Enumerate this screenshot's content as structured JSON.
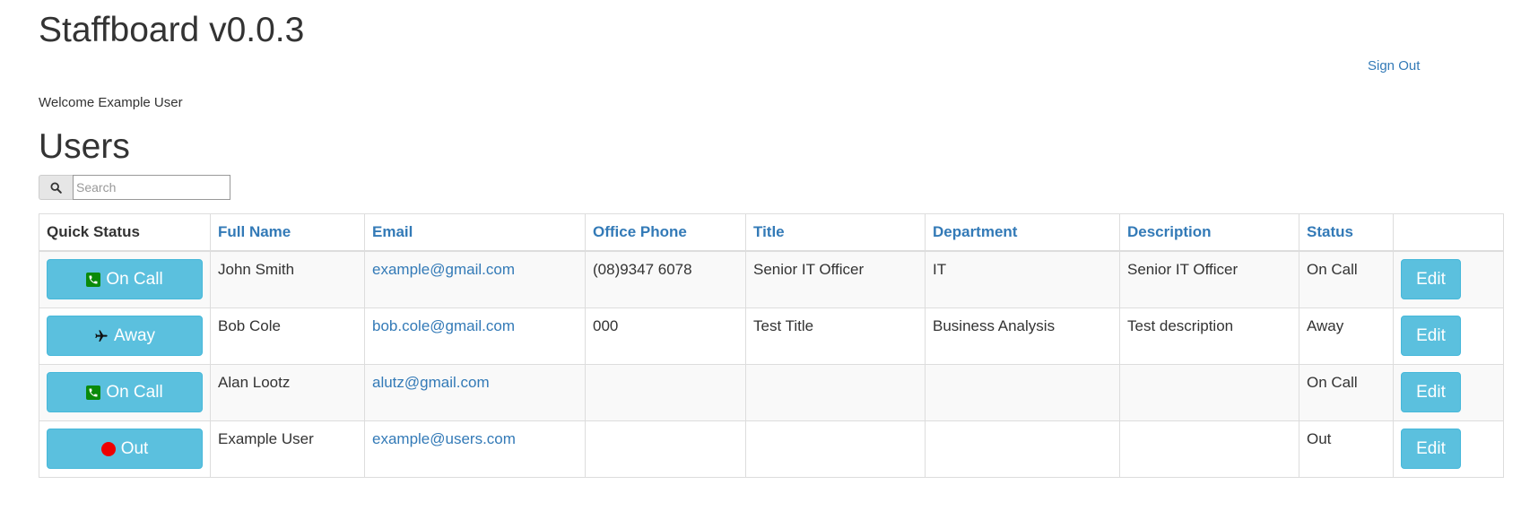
{
  "header": {
    "app_title": "Staffboard v0.0.3",
    "sign_out": "Sign Out",
    "welcome": "Welcome Example User"
  },
  "section_title": "Users",
  "search": {
    "placeholder": "Search",
    "value": ""
  },
  "table": {
    "columns": [
      "Quick Status",
      "Full Name",
      "Email",
      "Office Phone",
      "Title",
      "Department",
      "Description",
      "Status",
      ""
    ],
    "rows": [
      {
        "quick_status": "On Call",
        "quick_icon": "phone-icon",
        "name": "John Smith",
        "email": "example@gmail.com",
        "phone": "(08)9347 6078",
        "title": "Senior IT Officer",
        "department": "IT",
        "description": "Senior IT Officer",
        "status": "On Call",
        "edit": "Edit"
      },
      {
        "quick_status": "Away",
        "quick_icon": "airplane-icon",
        "name": "Bob Cole",
        "email": "bob.cole@gmail.com",
        "phone": "000",
        "title": "Test Title",
        "department": "Business Analysis",
        "description": "Test description",
        "status": "Away",
        "edit": "Edit"
      },
      {
        "quick_status": "On Call",
        "quick_icon": "phone-icon",
        "name": "Alan Lootz",
        "email": "alutz@gmail.com",
        "phone": "",
        "title": "",
        "department": "",
        "description": "",
        "status": "On Call",
        "edit": "Edit"
      },
      {
        "quick_status": "Out",
        "quick_icon": "red-dot-icon",
        "name": "Example User",
        "email": "example@users.com",
        "phone": "",
        "title": "",
        "department": "",
        "description": "",
        "status": "Out",
        "edit": "Edit"
      }
    ]
  },
  "colors": {
    "link": "#337ab7",
    "info_button": "#5bc0de",
    "phone_icon": "#0a8a0a",
    "out_icon": "#ee0000"
  }
}
